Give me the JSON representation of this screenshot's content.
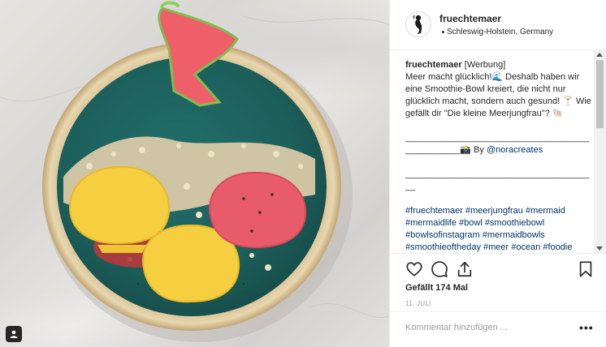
{
  "post": {
    "username": "fruechtemaer",
    "location": "Schleswig-Holstein, Germany"
  },
  "caption": {
    "user": "fruechtemaer",
    "line1": "[Werbung]",
    "line2": "Meer macht glücklich!🌊 Deshalb haben wir eine Smoothie-Bowl kreiert, die nicht nur glücklich macht, sondern auch gesund! 🍸 Wie gefällt dir \"Die kleine Meerjungfrau\"? 🐚",
    "rule1": "________________________________________________📸 By ",
    "credit": "@noracreates",
    "rule2": "_______________________________________",
    "hashtags": "#fruechtemaer #meerjungfrau #mermaid #mermaidlife #bowl #smoothiebowl #bowlsofinstagram #mermaidbowls #smoothieoftheday #meer #ocean #foodie #blogger_de #foodporn"
  },
  "stats": {
    "likes": "Gefällt 174 Mal",
    "date": "11. JULI"
  },
  "comment": {
    "placeholder": "Kommentar hinzufügen ...",
    "more": "•••"
  },
  "icons": [
    "tag-user-icon",
    "heart-icon",
    "comment-icon",
    "share-icon",
    "bookmark-icon",
    "more-options-icon"
  ],
  "colors": {
    "link": "#003569",
    "text": "#262626",
    "muted": "#999999",
    "border": "#efefef"
  }
}
